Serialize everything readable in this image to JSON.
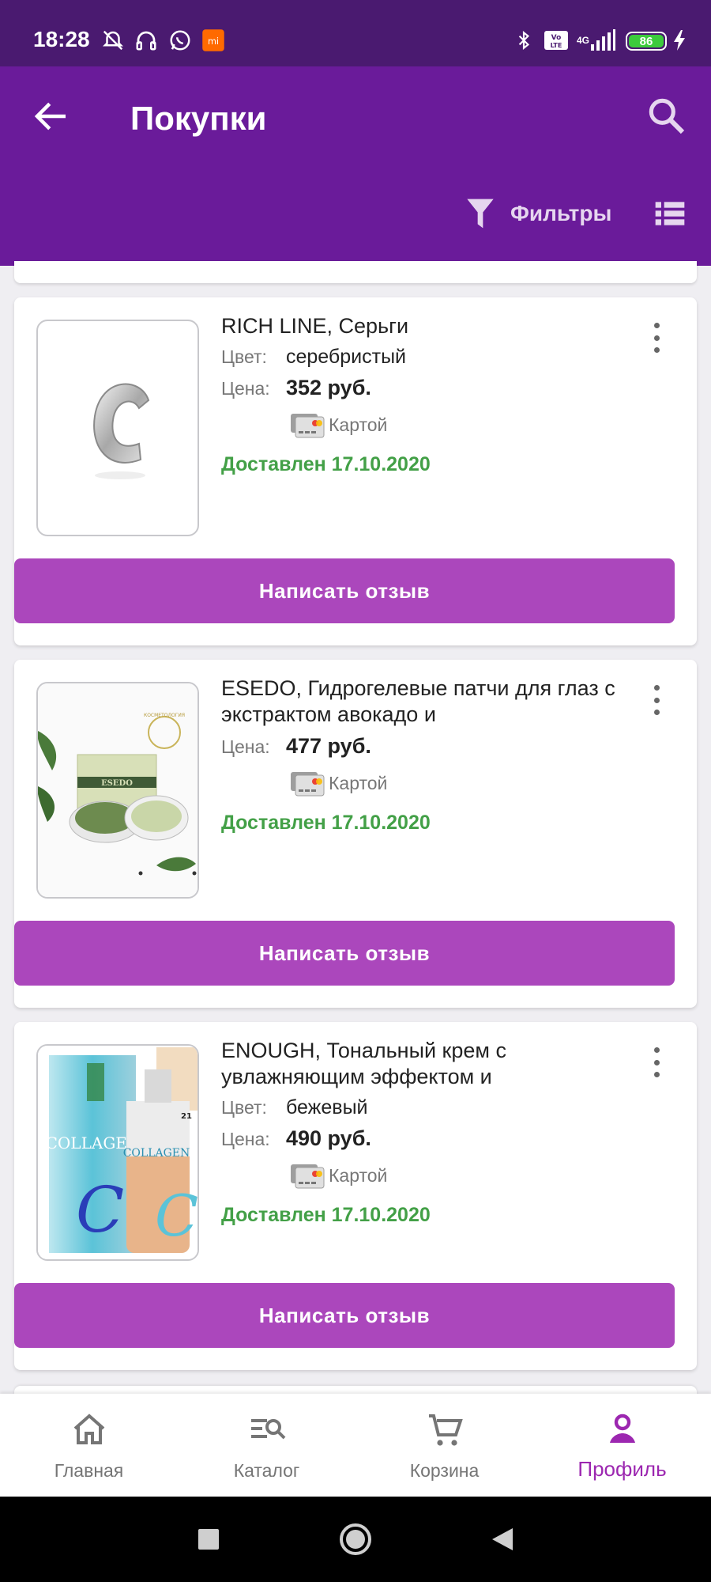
{
  "status_bar": {
    "time": "18:28",
    "battery": "86",
    "network": "4G",
    "left_icons": [
      "alarm-off-icon",
      "headphones-icon",
      "whatsapp-icon",
      "mi-app-icon"
    ],
    "right_icons": [
      "bluetooth-icon",
      "volte-icon",
      "signal-icon",
      "battery-icon",
      "charging-icon"
    ]
  },
  "appbar": {
    "title": "Покупки",
    "filter_label": "Фильтры",
    "colors": {
      "appbar": "#6a1b9a",
      "status": "#4a1a70"
    }
  },
  "orders": [
    {
      "name": "RICH LINE, Серьги",
      "color_label": "Цвет:",
      "color": "серебристый",
      "price_label": "Цена:",
      "price": "352 руб.",
      "payment": "Картой",
      "status": "Доставлен 17.10.2020",
      "review_button": "Написать отзыв",
      "image": "silver-earring"
    },
    {
      "name": "ESEDO, Гидрогелевые патчи для глаз с экстрактом авокадо и",
      "price_label": "Цена:",
      "price": "477 руб.",
      "payment": "Картой",
      "status": "Доставлен 17.10.2020",
      "review_button": "Написать отзыв",
      "image": "eye-patches",
      "image_texts": {
        "brand": "ESEDO",
        "seal": "КОСМЕТОЛОГИЯ"
      }
    },
    {
      "name": "ENOUGH, Тональный крем с увлажняющим эффектом и",
      "color_label": "Цвет:",
      "color": "бежевый",
      "price_label": "Цена:",
      "price": "490 руб.",
      "payment": "Картой",
      "status": "Доставлен 17.10.2020",
      "review_button": "Написать отзыв",
      "image": "collagen-foundation",
      "image_texts": {
        "brand": "COLLAGEN",
        "shade": "21"
      }
    }
  ],
  "bottom_nav": [
    {
      "label": "Главная",
      "icon": "home-icon",
      "active": false
    },
    {
      "label": "Каталог",
      "icon": "catalog-search-icon",
      "active": false
    },
    {
      "label": "Корзина",
      "icon": "cart-icon",
      "active": false
    },
    {
      "label": "Профиль",
      "icon": "profile-icon",
      "active": true
    }
  ],
  "colors": {
    "accent": "#ab47bc",
    "active": "#9c27b0",
    "delivered": "#43a047"
  }
}
